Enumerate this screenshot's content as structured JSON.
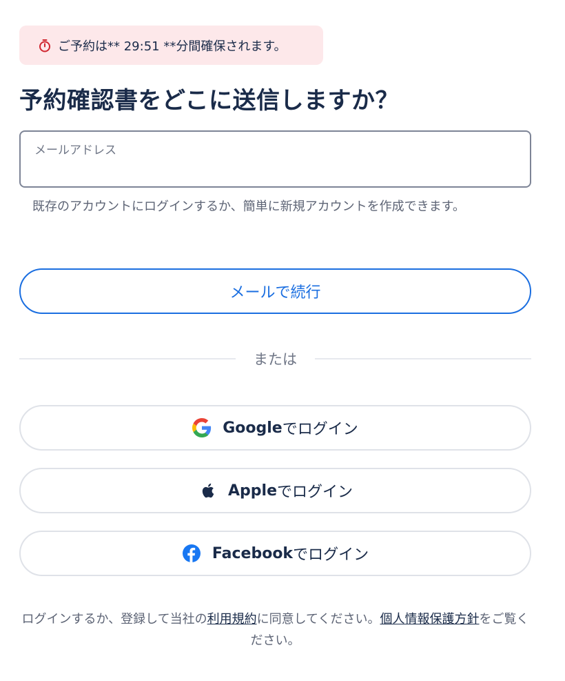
{
  "banner": {
    "text": "ご予約は** 29:51 **分間確保されます。",
    "icon": "stopwatch-icon",
    "color": "#fde8ea",
    "icon_color": "#d0262f"
  },
  "title": "予約確認書をどこに送信しますか？",
  "email": {
    "label": "メールアドレス",
    "value": "",
    "helper": "既存のアカウントにログインするか、簡単に新規アカウントを作成できます。"
  },
  "continue_button": {
    "label": "メールで続行",
    "color": "#1a6ee0"
  },
  "divider_text": "または",
  "social": {
    "google": {
      "brand": "Google",
      "suffix": "でログイン",
      "icon": "google-icon"
    },
    "apple": {
      "brand": "Apple",
      "suffix": "でログイン",
      "icon": "apple-icon"
    },
    "facebook": {
      "brand": "Facebook",
      "suffix": "でログイン",
      "icon": "facebook-icon",
      "color": "#1877f2"
    }
  },
  "legal": {
    "prefix": "ログインするか、登録して当社の",
    "terms_link": "利用規約",
    "middle": "に同意してください。",
    "privacy_link": "個人情報保護方針",
    "suffix": "をご覧ください。"
  }
}
